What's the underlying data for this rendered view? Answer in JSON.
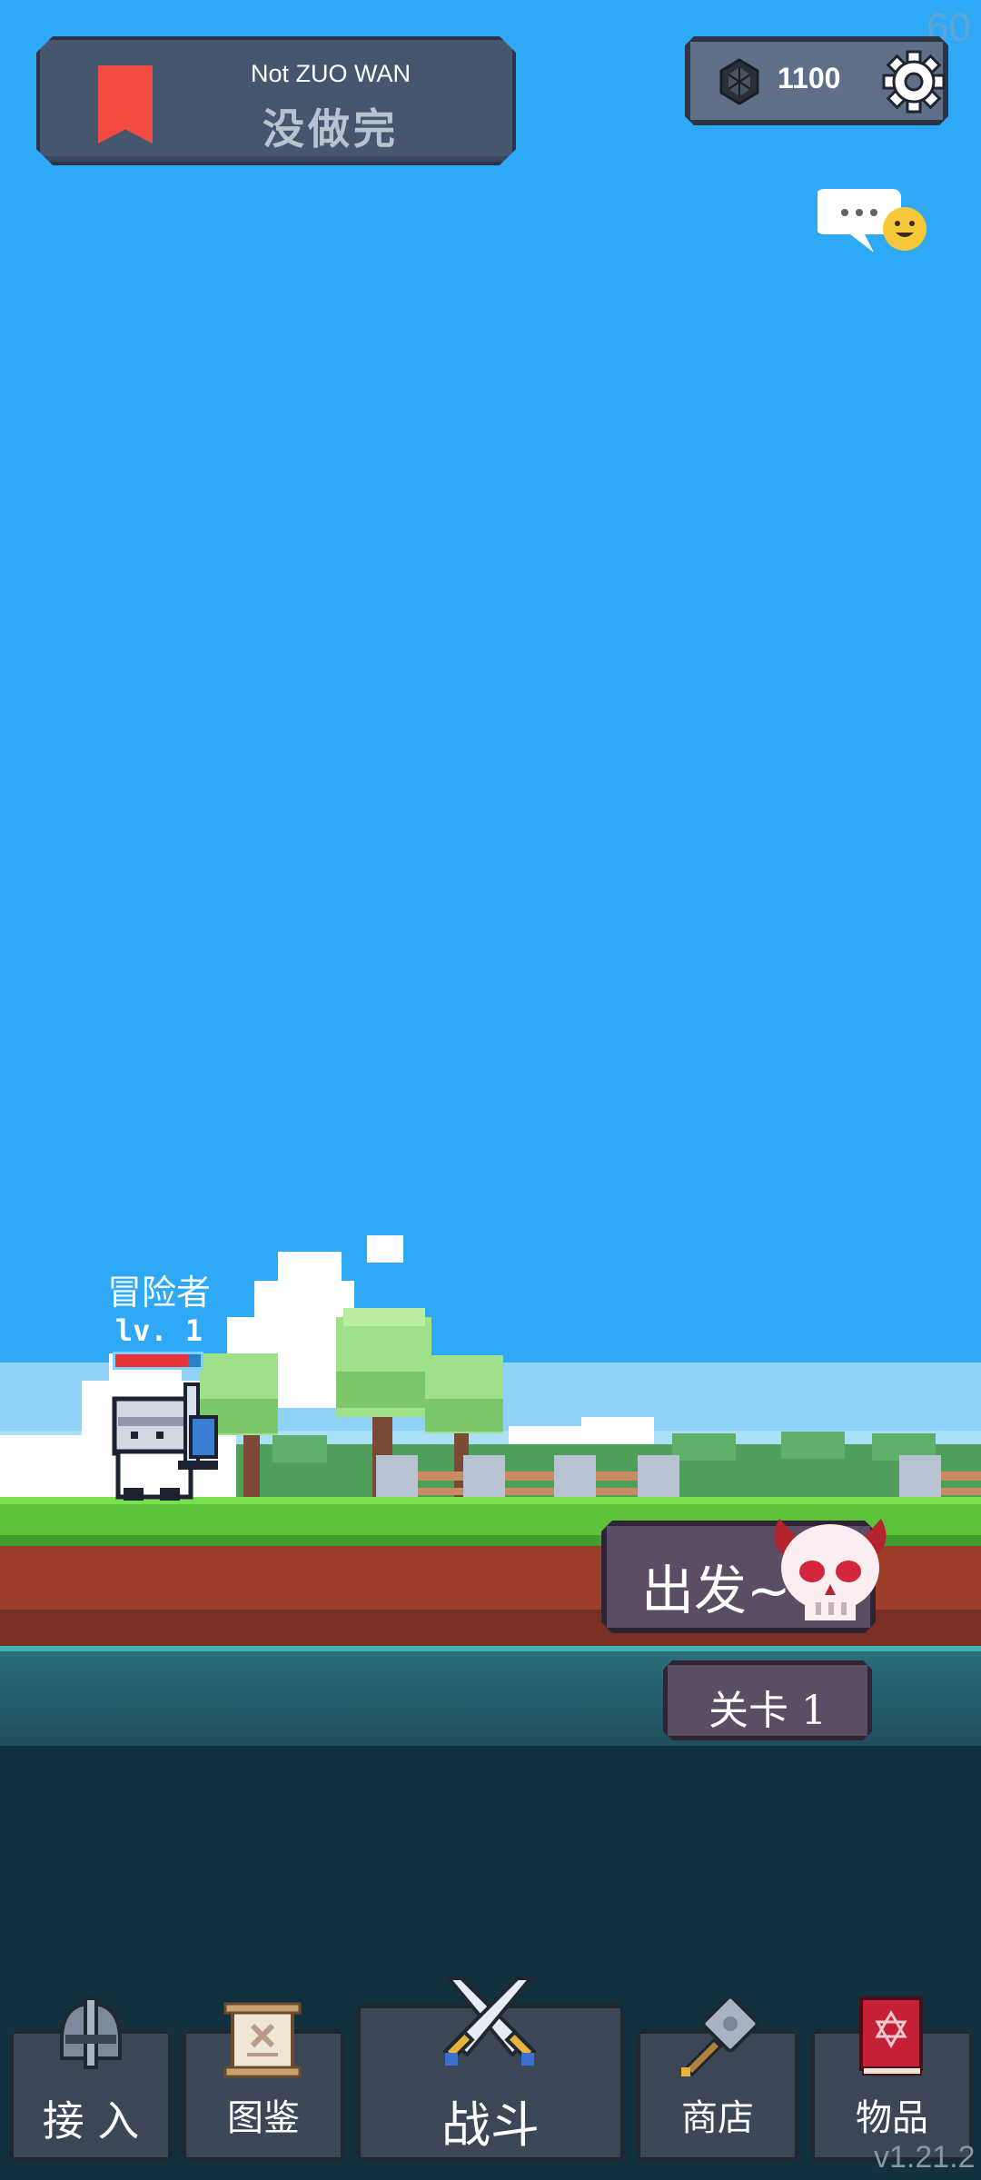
{
  "banner": {
    "subtitle": "Not ZUO WAN",
    "title": "没做完"
  },
  "currency": {
    "value": "1100"
  },
  "fps": "60",
  "hero": {
    "name": "冒险者",
    "level": "lv. 1",
    "hp_fraction": 0.85
  },
  "actions": {
    "go_label": "出发~",
    "level_label": "关卡 1"
  },
  "nav": [
    {
      "label": "接 入",
      "icon": "helmet-icon"
    },
    {
      "label": "图鉴",
      "icon": "scroll-icon"
    },
    {
      "label": "战斗",
      "icon": "crossed-swords-icon"
    },
    {
      "label": "商店",
      "icon": "hammer-icon"
    },
    {
      "label": "物品",
      "icon": "spellbook-icon"
    }
  ],
  "version": "v1.21.2",
  "colors": {
    "sky": "#2fa9f6",
    "bookmark": "#f24b3f",
    "button": "#5b4d63",
    "grass": "#5bc43a"
  }
}
